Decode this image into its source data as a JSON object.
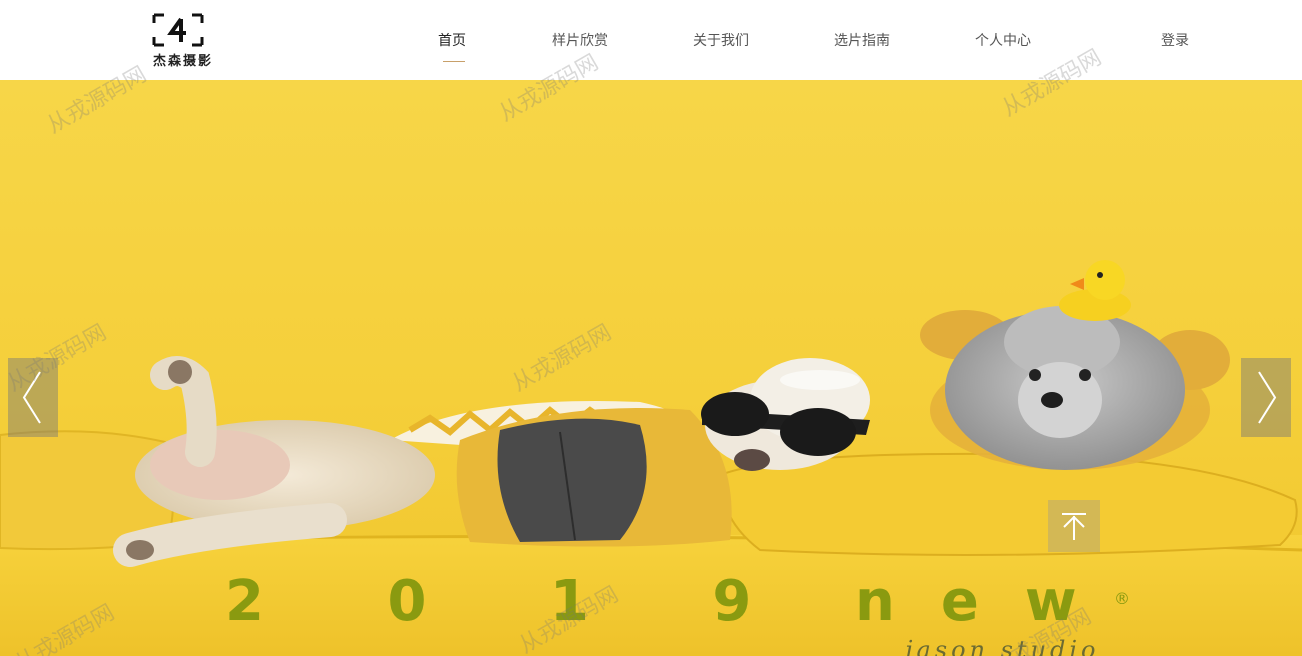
{
  "brand": {
    "logo_text": "杰森摄影",
    "logo_mark": "4"
  },
  "nav": {
    "items": [
      {
        "label": "首页",
        "active": true
      },
      {
        "label": "样片欣赏",
        "active": false
      },
      {
        "label": "关于我们",
        "active": false
      },
      {
        "label": "选片指南",
        "active": false
      },
      {
        "label": "个人中心",
        "active": false
      },
      {
        "label": "登录",
        "active": false
      }
    ]
  },
  "hero": {
    "headline_year": "2 0 1 9",
    "headline_word": "new",
    "trademark": "®",
    "script_text": "jason studio",
    "prev_icon": "chevron-left-icon",
    "next_icon": "chevron-right-icon"
  },
  "back_to_top": {
    "icon": "arrow-up-to-top-icon"
  },
  "watermark": {
    "text": "从戎源码网"
  },
  "colors": {
    "hero_yellow": "#f6d23d",
    "headline_olive": "#8a9a10",
    "nav_active_underline": "#c8a06a"
  }
}
